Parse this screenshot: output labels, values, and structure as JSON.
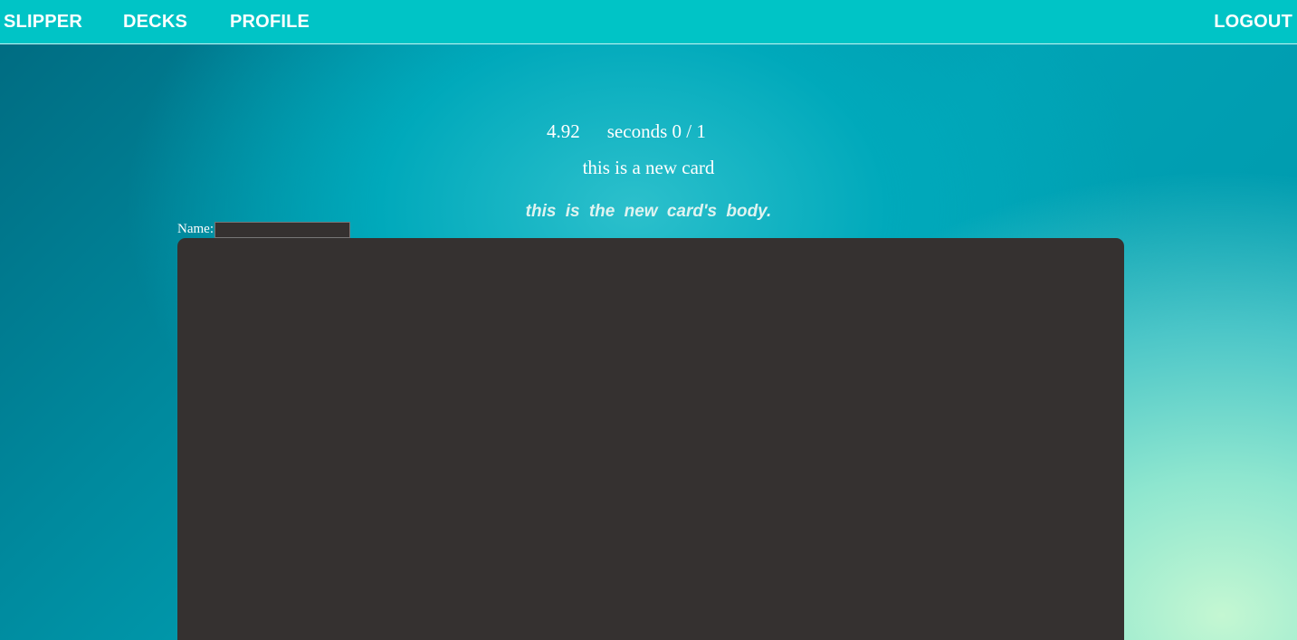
{
  "nav": {
    "brand": "SLIPPER",
    "decks": "DECKS",
    "profile": "PROFILE",
    "logout": "LOGOUT"
  },
  "study": {
    "seconds_value": "4.92",
    "progress_text": "seconds 0 / 1",
    "card_title": "this is a new card",
    "card_body": "this is the new card's body."
  },
  "form": {
    "name_label": "Name:",
    "name_value": ""
  },
  "colors": {
    "topbar": "#00c4c6",
    "panel": "#353130"
  }
}
